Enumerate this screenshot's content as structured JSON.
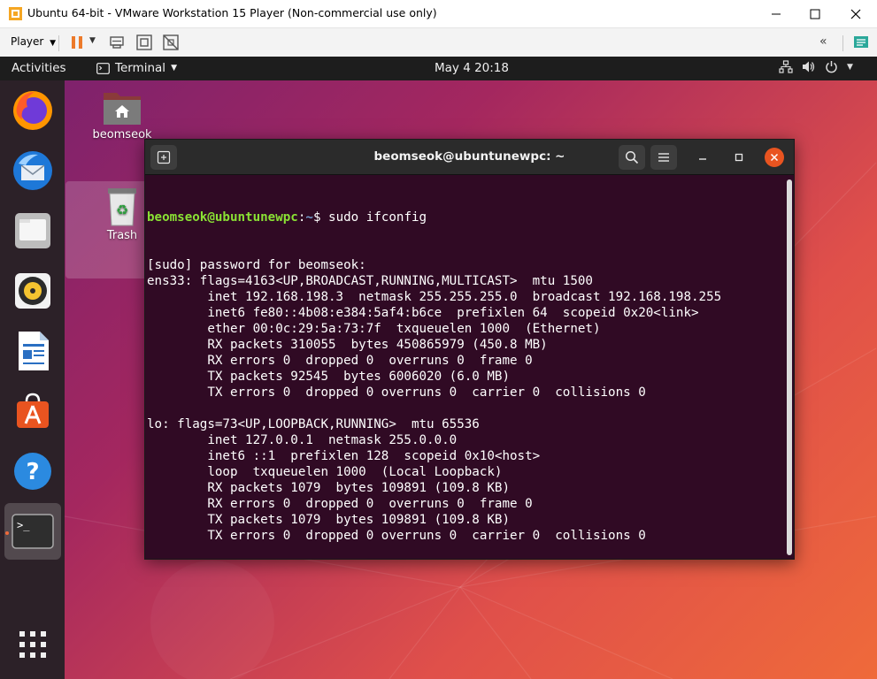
{
  "vmware": {
    "window_title": "Ubuntu 64-bit - VMware Workstation 15 Player (Non-commercial use only)",
    "player_menu": "Player",
    "icons": [
      "pause-icon",
      "send-ctrl-alt-del-icon",
      "fit-guest-icon",
      "unity-icon",
      "collapse-toolbar-icon",
      "message-log-icon"
    ]
  },
  "topbar": {
    "activities": "Activities",
    "app_menu": "Terminal",
    "clock": "May 4  20:18",
    "tray_icons": [
      "network-icon",
      "volume-icon",
      "power-icon",
      "menu-arrow-icon"
    ]
  },
  "dock": {
    "items": [
      {
        "name": "Firefox",
        "icon": "firefox-icon"
      },
      {
        "name": "Thunderbird",
        "icon": "thunderbird-icon"
      },
      {
        "name": "Files",
        "icon": "files-icon"
      },
      {
        "name": "Rhythmbox",
        "icon": "rhythmbox-icon"
      },
      {
        "name": "LibreOffice Writer",
        "icon": "writer-icon"
      },
      {
        "name": "Ubuntu Software",
        "icon": "software-icon"
      },
      {
        "name": "Help",
        "icon": "help-icon"
      },
      {
        "name": "Terminal",
        "icon": "terminal-icon",
        "active": true
      }
    ],
    "show_apps_icon": "app-grid-icon"
  },
  "desktop": {
    "home_label": "beomseok",
    "trash_label": "Trash"
  },
  "terminal": {
    "title": "beomseok@ubuntunewpc: ~",
    "prompt_user": "beomseok@ubuntunewpc",
    "prompt_sep": ":",
    "prompt_path": "~",
    "prompt_dollar": "$ ",
    "command": "sudo ifconfig",
    "output": [
      "[sudo] password for beomseok:",
      "ens33: flags=4163<UP,BROADCAST,RUNNING,MULTICAST>  mtu 1500",
      "        inet 192.168.198.3  netmask 255.255.255.0  broadcast 192.168.198.255",
      "        inet6 fe80::4b08:e384:5af4:b6ce  prefixlen 64  scopeid 0x20<link>",
      "        ether 00:0c:29:5a:73:7f  txqueuelen 1000  (Ethernet)",
      "        RX packets 310055  bytes 450865979 (450.8 MB)",
      "        RX errors 0  dropped 0  overruns 0  frame 0",
      "        TX packets 92545  bytes 6006020 (6.0 MB)",
      "        TX errors 0  dropped 0 overruns 0  carrier 0  collisions 0",
      "",
      "lo: flags=73<UP,LOOPBACK,RUNNING>  mtu 65536",
      "        inet 127.0.0.1  netmask 255.0.0.0",
      "        inet6 ::1  prefixlen 128  scopeid 0x10<host>",
      "        loop  txqueuelen 1000  (Local Loopback)",
      "        RX packets 1079  bytes 109891 (109.8 KB)",
      "        RX errors 0  dropped 0  overruns 0  frame 0",
      "        TX packets 1079  bytes 109891 (109.8 KB)",
      "        TX errors 0  dropped 0 overruns 0  carrier 0  collisions 0",
      ""
    ],
    "colors": {
      "background": "#300a24",
      "user": "#8ae234",
      "path": "#729fcf"
    }
  }
}
